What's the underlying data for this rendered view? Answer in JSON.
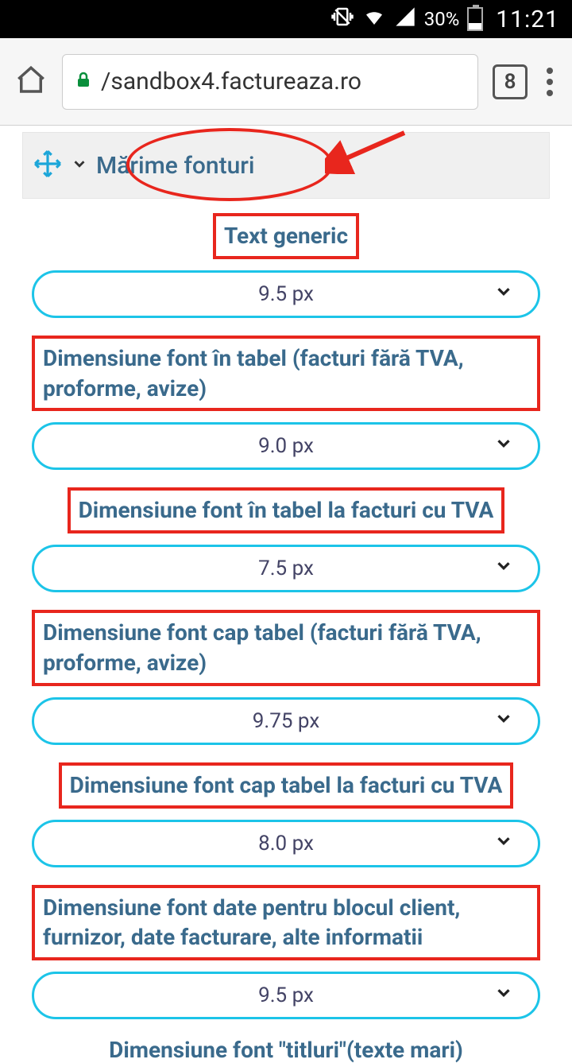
{
  "status": {
    "battery_pct": "30%",
    "time": "11:21"
  },
  "browser": {
    "url": "/sandbox4.factureaza.ro",
    "tab_count": "8"
  },
  "section": {
    "title": "Mărime fonturi"
  },
  "fields": [
    {
      "label": "Text generic",
      "value": "9.5 px",
      "align": "center"
    },
    {
      "label": "Dimensiune font în tabel (facturi fără TVA, proforme, avize)",
      "value": "9.0 px",
      "align": "left"
    },
    {
      "label": "Dimensiune font în tabel la facturi cu TVA",
      "value": "7.5 px",
      "align": "center"
    },
    {
      "label": "Dimensiune font cap tabel (facturi fără TVA, proforme, avize)",
      "value": "9.75 px",
      "align": "left"
    },
    {
      "label": "Dimensiune font cap tabel la facturi cu TVA",
      "value": "8.0 px",
      "align": "center"
    },
    {
      "label": "Dimensiune font date pentru blocul client, furnizor, date facturare, alte informatii",
      "value": "9.5 px",
      "align": "left"
    }
  ],
  "bottom_label": "Dimensiune font \"titluri\"(texte mari)"
}
